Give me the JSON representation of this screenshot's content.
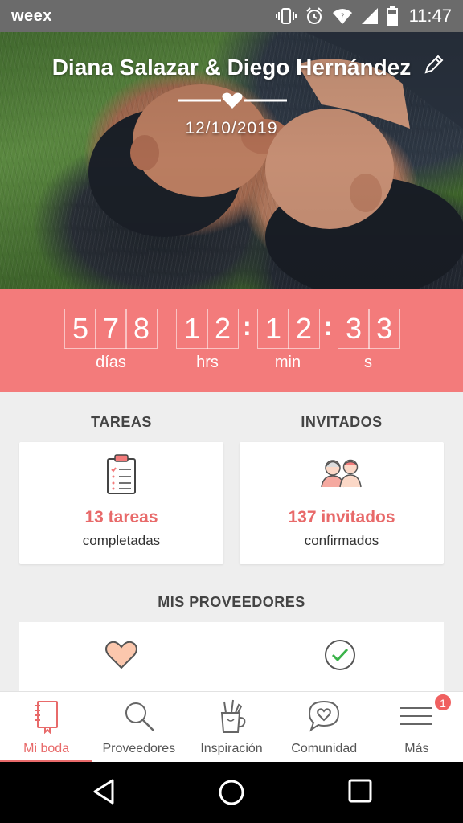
{
  "status_bar": {
    "app_name": "weex",
    "time": "11:47",
    "icons": [
      "vibrate-icon",
      "alarm-icon",
      "wifi-icon",
      "signal-icon",
      "battery-icon"
    ]
  },
  "hero": {
    "couple_names": "Diana Salazar & Diego Hernández",
    "wedding_date": "12/10/2019",
    "photo_description": "couple-photo"
  },
  "countdown": {
    "days_digits": [
      "5",
      "7",
      "8"
    ],
    "hours_digits": [
      "1",
      "2"
    ],
    "minutes_digits": [
      "1",
      "2"
    ],
    "seconds_digits": [
      "3",
      "3"
    ],
    "separator": ":",
    "labels": {
      "days": "días",
      "hours": "hrs",
      "minutes": "min",
      "seconds": "s"
    }
  },
  "tasks": {
    "title": "TAREAS",
    "value": "13 tareas",
    "caption": "completadas"
  },
  "guests": {
    "title": "INVITADOS",
    "value": "137 invitados",
    "caption": "confirmados"
  },
  "providers": {
    "title": "MIS PROVEEDORES"
  },
  "bottom_nav": {
    "items": [
      {
        "label": "Mi boda",
        "icon": "notebook-icon",
        "active": true
      },
      {
        "label": "Proveedores",
        "icon": "search-icon",
        "active": false
      },
      {
        "label": "Inspiración",
        "icon": "pencil-cup-icon",
        "active": false
      },
      {
        "label": "Comunidad",
        "icon": "chat-heart-icon",
        "active": false
      },
      {
        "label": "Más",
        "icon": "menu-icon",
        "active": false,
        "badge": "1"
      }
    ]
  },
  "colors": {
    "accent": "#f37b7b",
    "accent_text": "#e86a6a",
    "background": "#eeeeee",
    "status_bar": "#6b6b6b"
  }
}
